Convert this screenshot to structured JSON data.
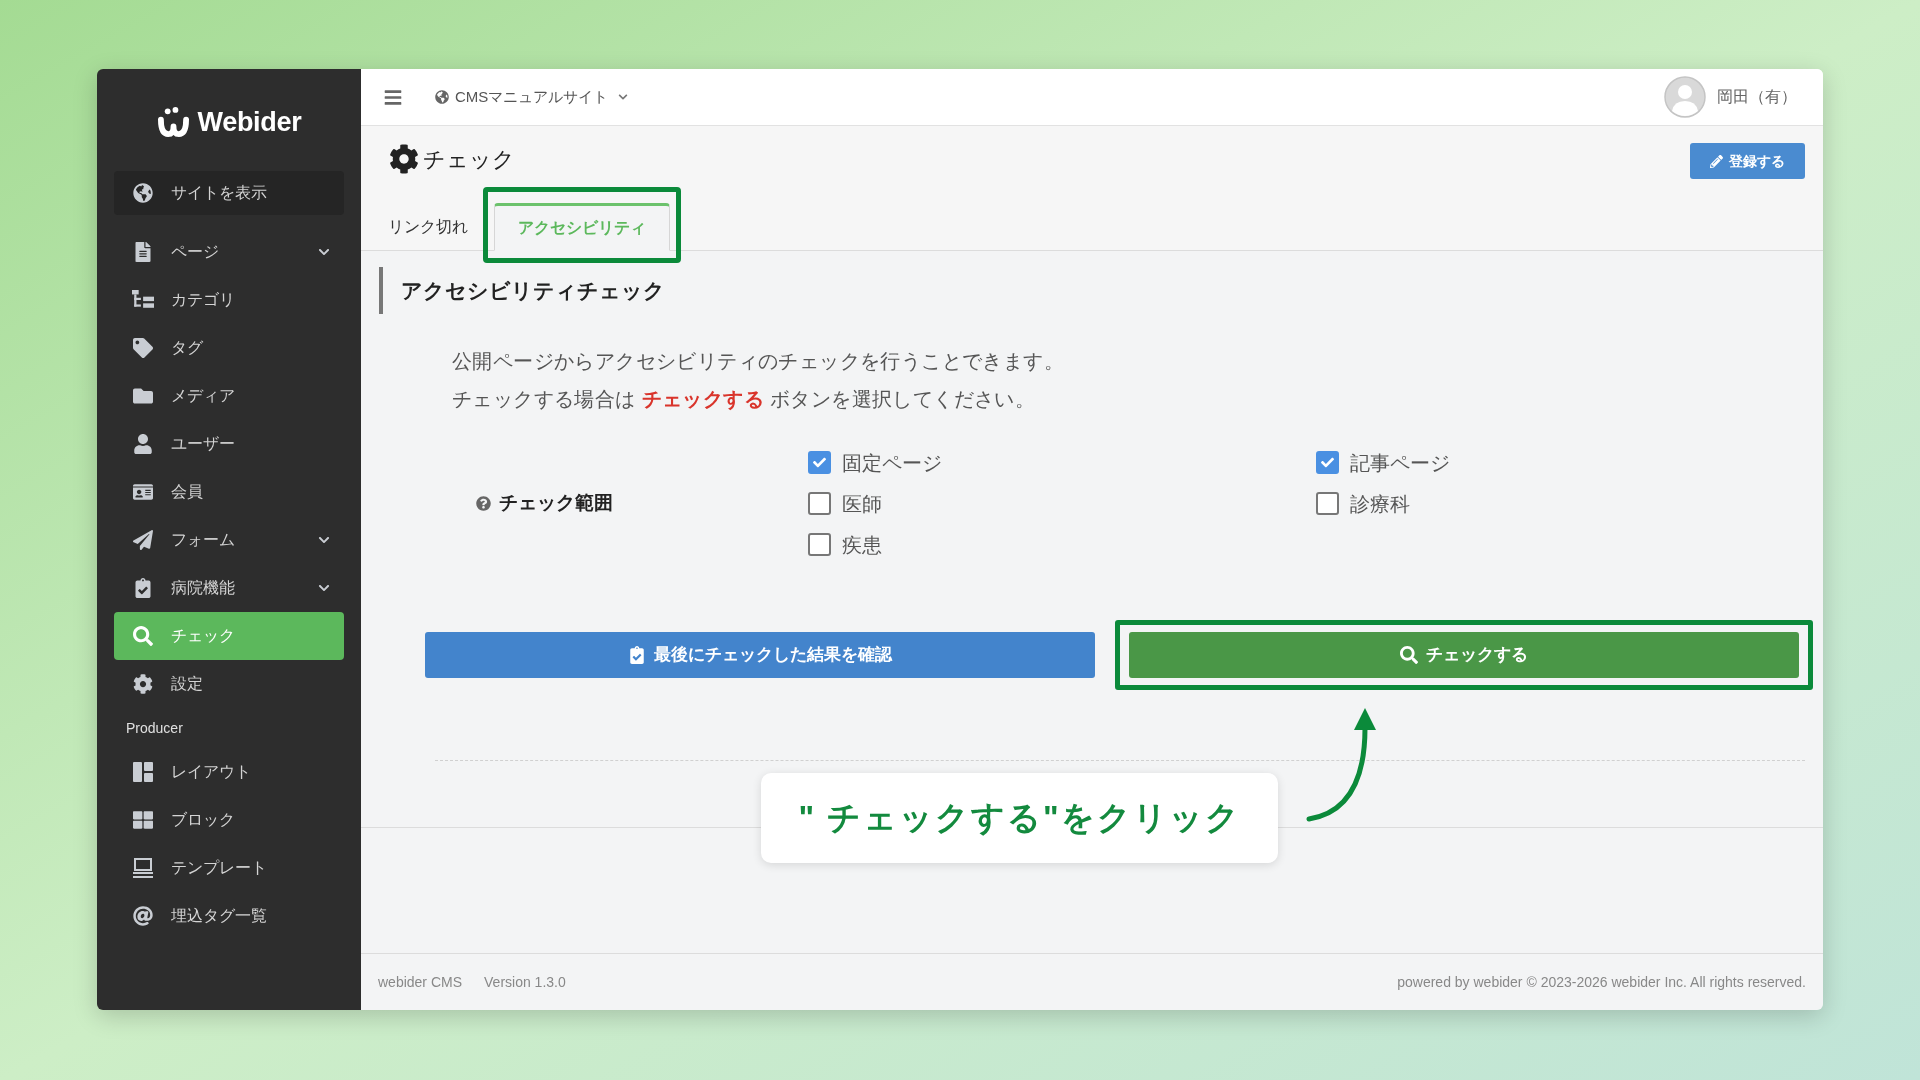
{
  "sidebar": {
    "logo": "Webider",
    "view_site": "サイトを表示",
    "items": [
      {
        "label": "ページ",
        "has_submenu": true,
        "selected": false
      },
      {
        "label": "カテゴリ",
        "has_submenu": false,
        "selected": false
      },
      {
        "label": "タグ",
        "has_submenu": false,
        "selected": false
      },
      {
        "label": "メディア",
        "has_submenu": false,
        "selected": false
      },
      {
        "label": "ユーザー",
        "has_submenu": false,
        "selected": false
      },
      {
        "label": "会員",
        "has_submenu": false,
        "selected": false
      },
      {
        "label": "フォーム",
        "has_submenu": true,
        "selected": false
      },
      {
        "label": "病院機能",
        "has_submenu": true,
        "selected": false
      },
      {
        "label": "チェック",
        "has_submenu": false,
        "selected": true
      },
      {
        "label": "設定",
        "has_submenu": false,
        "selected": false
      }
    ],
    "section_title": "Producer",
    "producer_items": [
      {
        "label": "レイアウト",
        "selected": false
      },
      {
        "label": "ブロック",
        "selected": false
      },
      {
        "label": "テンプレート",
        "selected": false
      },
      {
        "label": "埋込タグ一覧",
        "selected": false
      }
    ]
  },
  "topbar": {
    "site": "CMSマニュアルサイト",
    "user": "岡田（有）"
  },
  "header": {
    "title": "チェック",
    "save_button": "登録する"
  },
  "tabs": [
    {
      "label": "リンク切れ",
      "selected": false,
      "highlighted": false
    },
    {
      "label": "アクセシビリティ",
      "selected": true,
      "highlighted": true
    }
  ],
  "section": {
    "heading": "アクセシビリティチェック",
    "description": [
      "公開ページからアクセシビリティのチェックを行うことできます。",
      "チェックする場合は **チェックする** ボタンを選択してください。"
    ],
    "scope": {
      "label": "チェック範囲",
      "options": [
        {
          "label": "固定ページ",
          "checked": true
        },
        {
          "label": "記事ページ",
          "checked": true
        },
        {
          "label": "医師",
          "checked": false
        },
        {
          "label": "診療科",
          "checked": false
        },
        {
          "label": "疾患",
          "checked": false
        }
      ]
    },
    "buttons": [
      {
        "label": "最後にチェックした結果を確認",
        "kind": "results",
        "highlighted": false
      },
      {
        "label": "チェックする",
        "kind": "run",
        "highlighted": true
      }
    ]
  },
  "callout": "\" チェックする\"をクリック",
  "footer": {
    "product": "webider CMS",
    "version": "Version 1.3.0",
    "copyright": "powered by webider © 2023-2026 webider Inc. All rights reserved."
  }
}
